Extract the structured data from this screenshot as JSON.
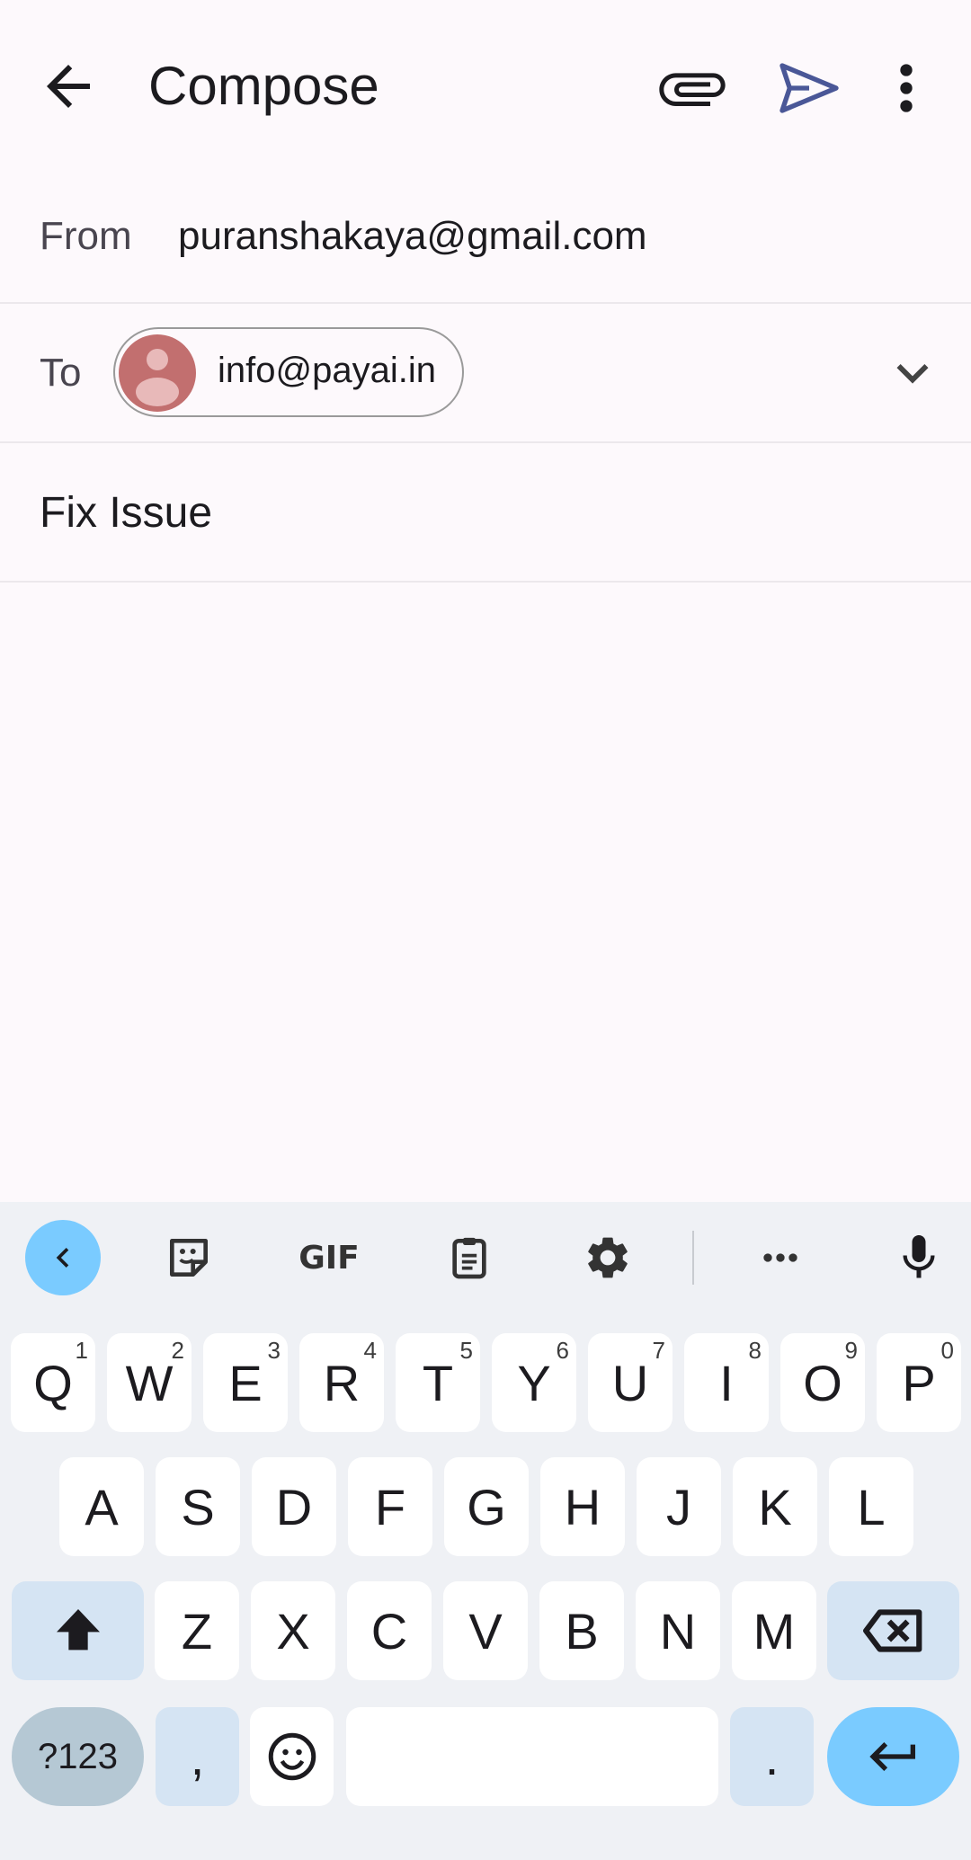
{
  "appbar": {
    "title": "Compose",
    "icons": [
      "back-arrow-icon",
      "attachment-icon",
      "send-icon",
      "more-vert-icon"
    ],
    "send_color": "#4a5797"
  },
  "from": {
    "label": "From",
    "value": "puranshakaya@gmail.com"
  },
  "to": {
    "label": "To",
    "recipient": "info@payai.in",
    "avatar_color": "#c26f6f"
  },
  "subject": {
    "value": "Fix Issue"
  },
  "keyboard": {
    "toolbar": [
      "collapse-icon",
      "sticker-icon",
      "GIF",
      "clipboard-icon",
      "settings-icon",
      "more-horiz-icon",
      "mic-icon"
    ],
    "row1": [
      {
        "k": "Q",
        "s": "1"
      },
      {
        "k": "W",
        "s": "2"
      },
      {
        "k": "E",
        "s": "3"
      },
      {
        "k": "R",
        "s": "4"
      },
      {
        "k": "T",
        "s": "5"
      },
      {
        "k": "Y",
        "s": "6"
      },
      {
        "k": "U",
        "s": "7"
      },
      {
        "k": "I",
        "s": "8"
      },
      {
        "k": "O",
        "s": "9"
      },
      {
        "k": "P",
        "s": "0"
      }
    ],
    "row2": [
      "A",
      "S",
      "D",
      "F",
      "G",
      "H",
      "J",
      "K",
      "L"
    ],
    "row3": [
      "Z",
      "X",
      "C",
      "V",
      "B",
      "N",
      "M"
    ],
    "numbers_label": "?123",
    "comma": ",",
    "period": ".",
    "accent": "#7acbff"
  }
}
